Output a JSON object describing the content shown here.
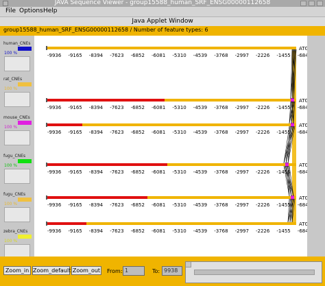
{
  "window": {
    "title": "JAVA Sequence Viewer - group15588_human_SRF_ENSG00000112658"
  },
  "menubar": {
    "items": [
      "File",
      "Options",
      "Help"
    ]
  },
  "applet": {
    "title": "Java Applet Window"
  },
  "header": {
    "text": "group15588_human_SRF_ENSG00000112658 / Number of feature types: 6"
  },
  "legend": [
    {
      "label": "human_CNEs",
      "color": "#1010c8",
      "percent": "100 %",
      "pct_color": "#1010c8"
    },
    {
      "label": "rat_CNEs",
      "color": "#f0c040",
      "percent": "100 %",
      "pct_color": "#e8b830"
    },
    {
      "label": "mouse_CNEs",
      "color": "#e020e0",
      "percent": "100 %",
      "pct_color": "#d020d0"
    },
    {
      "label": "fugu_CNEs",
      "color": "#10e010",
      "percent": "100 %",
      "pct_color": "#10c010"
    },
    {
      "label": "fugu_CNEs",
      "color": "#f0c040",
      "percent": "100 %",
      "pct_color": "#e8b830"
    },
    {
      "label": "zebra_CNEs",
      "color": "#f0f030",
      "percent": "100 %",
      "pct_color": "#d8d820"
    }
  ],
  "tracks": {
    "atg_label": "ATG",
    "tick_labels": [
      "-9936",
      "-9165",
      "-8394",
      "-7623",
      "-6852",
      "-6081",
      "-5310",
      "-4539",
      "-3768",
      "-2997",
      "-2226",
      "-1455",
      "-684"
    ],
    "colors": {
      "track": "#f0b400",
      "red": "#e01010",
      "marker": "#e020e0",
      "lines": "#111111"
    }
  },
  "bottom": {
    "zoom_in": "Zoom_in",
    "zoom_default": "Zoom_default",
    "zoom_out": "Zoom_out",
    "from_label": "From:",
    "from_value": "1",
    "to_label": "To:",
    "to_value": "9938"
  }
}
